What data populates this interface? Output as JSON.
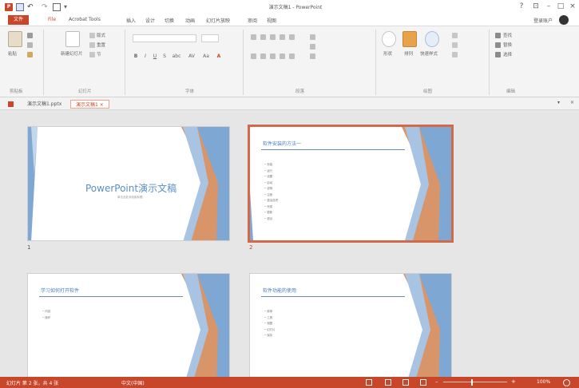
{
  "window": {
    "app_logo": "P",
    "title": "演示文稿1 - PowerPoint",
    "help": "?",
    "ribbon_display": "⊡",
    "minimize": "–",
    "maximize": "□",
    "close": "×"
  },
  "quick_access": {
    "undo": "↶",
    "redo": "↷",
    "more": "▾"
  },
  "ribbon_tabs": {
    "file": "文件",
    "tabs": [
      "File",
      "Acrobat Tools",
      "插入",
      "设计",
      "切换",
      "动画",
      "幻灯片放映",
      "审阅",
      "视图"
    ],
    "active_index": 0,
    "signin": "登录账户",
    "colors": {
      "accent": "#c8472b"
    }
  },
  "ribbon": {
    "groups": [
      "剪贴板",
      "幻灯片",
      "字体",
      "段落",
      "绘图",
      "编辑"
    ],
    "clipboard": {
      "paste": "粘贴"
    },
    "slides": {
      "new_slide": "新建幻灯片",
      "layout": "版式",
      "reset": "重置",
      "section": "节"
    },
    "drawing": {
      "shapes": "形状",
      "arrange": "排列",
      "quick_styles": "快速样式"
    },
    "editing": {
      "find": "查找",
      "replace": "替换",
      "select": "选择"
    },
    "format_buttons": [
      "B",
      "I",
      "U",
      "S",
      "abc",
      "AV",
      "Aa",
      "A"
    ]
  },
  "doc_tabs": {
    "items": [
      "演示文稿1.pptx",
      "演示文稿1 ×"
    ],
    "active_index": 1,
    "menu": "▾",
    "close": "×"
  },
  "slides": [
    {
      "number": "1",
      "title": "PowerPoint演示文稿",
      "subtitle": "单击此处添加副标题"
    },
    {
      "number": "2",
      "heading": "软件安装的方法一",
      "bullets": [
        "安装",
        "运行",
        "设置",
        "启动",
        "说明",
        "注册",
        "激活选项",
        "完成",
        "更新",
        "退出"
      ]
    },
    {
      "number": "3",
      "heading": "学习如何打开软件",
      "bullets": [
        "内容",
        "操作"
      ]
    },
    {
      "number": "4",
      "heading": "软件功能的使用",
      "bullets": [
        "菜单",
        "工具",
        "视图",
        "幻灯片",
        "保存"
      ]
    }
  ],
  "status": {
    "text": "幻灯片 第 2 张，共 4 张",
    "language": "中文(中国)",
    "zoom_minus": "–",
    "zoom_plus": "+",
    "zoom": "100%"
  }
}
